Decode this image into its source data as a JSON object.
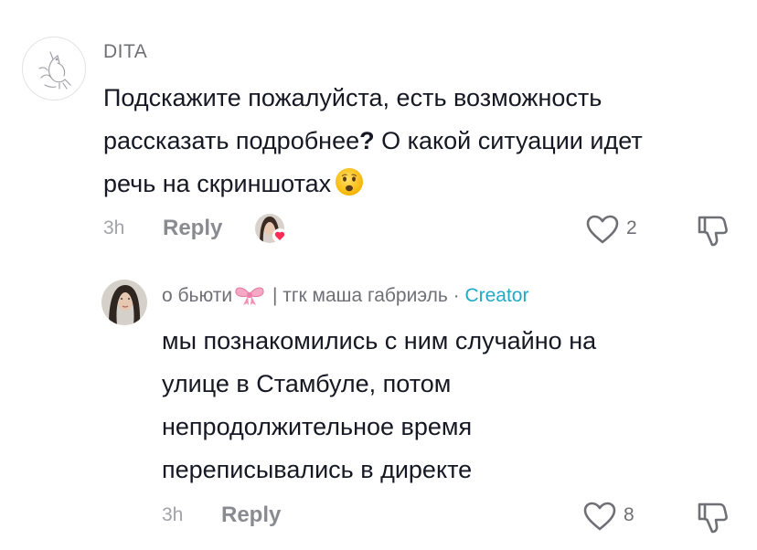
{
  "comment": {
    "username": "DITA",
    "text_line1": "Подскажите пожалуйста, есть возможность",
    "text_line2_before": "рассказать подробнее",
    "text_line2_q": "?",
    "text_line2_after": " О какой ситуации идет",
    "text_line3": "речь на скриншотах",
    "emoji": "frowning-face-emoji",
    "time": "3h",
    "reply_label": "Reply",
    "like_count": "2"
  },
  "reply": {
    "username_part1": "о бьюти",
    "username_part2": " | тгк маша габриэль · ",
    "creator_badge": "Creator",
    "text_line1": "мы познакомились с ним случайно на",
    "text_line2": "улице в Стамбуле, потом",
    "text_line3": "непродолжительное время",
    "text_line4": "переписывались в директе",
    "time": "3h",
    "reply_label": "Reply",
    "like_count": "8"
  },
  "colors": {
    "text": "#161823",
    "secondary": "#6f7076",
    "muted": "#a2a3a8",
    "creator": "#20a9c7",
    "liked_heart": "#fe2c55"
  },
  "icons": [
    "fox-sketch-avatar",
    "heart-outline-icon",
    "thumbs-down-icon",
    "pink-bow-emoji",
    "frowning-face-emoji",
    "liked-heart-badge"
  ]
}
